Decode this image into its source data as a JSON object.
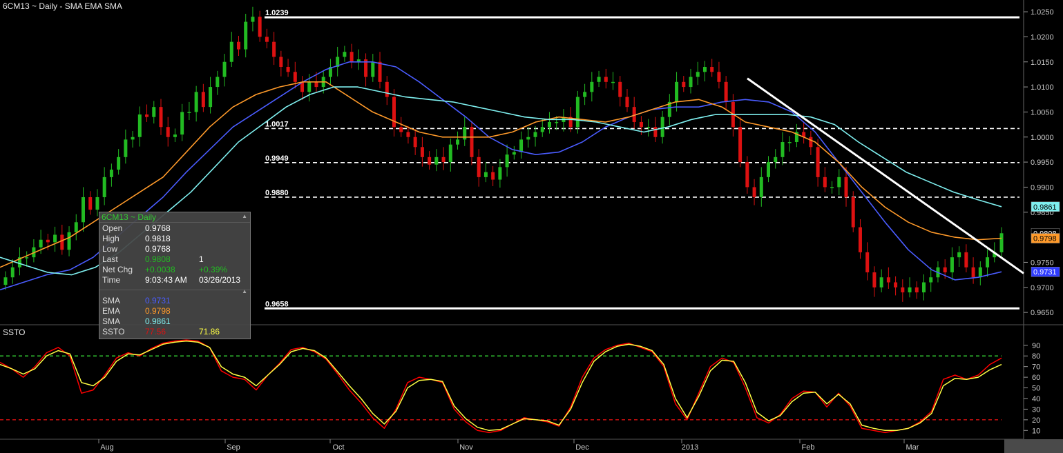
{
  "title": "6CM13 ~ Daily  -  SMA EMA SMA",
  "oscillator_title": "SSTO",
  "info_panel": {
    "header": "6CM13 ~ Daily",
    "rows": [
      {
        "label": "Open",
        "value": "0.9768",
        "value2": "",
        "color": "#ffffff"
      },
      {
        "label": "High",
        "value": "0.9818",
        "value2": "",
        "color": "#ffffff"
      },
      {
        "label": "Low",
        "value": "0.9768",
        "value2": "",
        "color": "#ffffff"
      },
      {
        "label": "Last",
        "value": "0.9808",
        "value2": "1",
        "color": "#22bb22"
      },
      {
        "label": "Net Chg",
        "value": "+0.0038",
        "value2": "+0.39%",
        "color": "#22bb22"
      },
      {
        "label": "Time",
        "value": "9:03:43 AM",
        "value2": "03/26/2013",
        "color": "#ffffff"
      }
    ],
    "studies": [
      {
        "label": "SMA",
        "value": "0.9731",
        "value2": "",
        "color": "#4a5cff"
      },
      {
        "label": "EMA",
        "value": "0.9798",
        "value2": "",
        "color": "#ff9a2a"
      },
      {
        "label": "SMA",
        "value": "0.9861",
        "value2": "",
        "color": "#7ff0f0"
      },
      {
        "label": "SSTO",
        "value": "77.56",
        "value2": "71.86",
        "color": "#dd1111",
        "color2": "#ffff44"
      }
    ]
  },
  "colors": {
    "background": "#000000",
    "up_candle": "#22bb22",
    "down_candle": "#dd1111",
    "sma_fast": "#4a5cff",
    "ema": "#ff9a2a",
    "sma_slow": "#7ff0f0",
    "ssto_k": "#ff0000",
    "ssto_d": "#ffff44",
    "level_line": "#ffffff",
    "axis_text": "#cccccc"
  },
  "chart_data": [
    {
      "type": "candlestick",
      "title": "6CM13 ~ Daily",
      "x_ticks": [
        "Aug",
        "Sep",
        "Oct",
        "Nov",
        "Dec",
        "2013",
        "Feb",
        "Mar"
      ],
      "y_ticks": [
        "1.0250",
        "1.0200",
        "1.0150",
        "1.0100",
        "1.0050",
        "1.0000",
        "0.9950",
        "0.9900",
        "0.9850",
        "0.9750",
        "0.9700",
        "0.9650"
      ],
      "ylim": [
        0.9635,
        1.0268
      ],
      "levels": [
        {
          "label": "1.0239",
          "value": 1.0239,
          "style": "solid"
        },
        {
          "label": "1.0017",
          "value": 1.0017,
          "style": "dashed"
        },
        {
          "label": "0.9949",
          "value": 0.9949,
          "style": "dashed"
        },
        {
          "label": "0.9880",
          "value": 0.988,
          "style": "dashed"
        },
        {
          "label": "0.9658",
          "value": 0.9658,
          "style": "solid"
        }
      ],
      "trendline": {
        "start": [
          "mid-Jan",
          1.0117
        ],
        "end": [
          "late-Mar",
          0.9728
        ]
      },
      "price_badges": [
        {
          "label": "0.9861",
          "value": 0.9861,
          "bg": "#7ff0f0",
          "fg": "#000000"
        },
        {
          "label": "0.9808",
          "value": 0.9808,
          "bg": "#000000",
          "fg": "#ffffff"
        },
        {
          "label": "0.9798",
          "value": 0.9798,
          "bg": "#ff9a2a",
          "fg": "#000000"
        },
        {
          "label": "0.9731",
          "value": 0.9731,
          "bg": "#2f3cff",
          "fg": "#ffffff"
        }
      ],
      "price_path": [
        0.972,
        0.974,
        0.976,
        0.976,
        0.978,
        0.9795,
        0.979,
        0.9805,
        0.9775,
        0.981,
        0.983,
        0.988,
        0.9855,
        0.988,
        0.992,
        0.9935,
        0.996,
        0.9995,
        1.0,
        1.0045,
        1.004,
        1.006,
        1.002,
        1.0,
        1.0005,
        1.005,
        1.005,
        1.009,
        1.006,
        1.01,
        1.012,
        1.015,
        1.019,
        1.0175,
        1.023,
        1.024,
        1.02,
        1.019,
        1.016,
        1.014,
        1.013,
        1.011,
        1.009,
        1.011,
        1.01,
        1.012,
        1.014,
        1.016,
        1.017,
        1.015,
        1.0155,
        1.012,
        1.015,
        1.011,
        1.008,
        1.002,
        1.001,
        1.0,
        0.998,
        0.996,
        0.9945,
        0.996,
        0.995,
        0.9985,
        0.9995,
        1.002,
        0.996,
        0.992,
        0.993,
        0.9915,
        0.994,
        0.9965,
        0.997,
        0.9995,
        1.0,
        1.001,
        1.002,
        1.003,
        1.003,
        1.004,
        1.002,
        1.008,
        1.009,
        1.011,
        1.012,
        1.011,
        1.011,
        1.008,
        1.006,
        1.003,
        1.002,
        1.002,
        1.0,
        1.004,
        1.007,
        1.011,
        1.01,
        1.012,
        1.013,
        1.014,
        1.013,
        1.011,
        1.007,
        1.002,
        0.995,
        0.99,
        0.988,
        0.992,
        0.995,
        0.996,
        0.999,
        0.999,
        1.001,
        1.0,
        0.998,
        0.992,
        0.99,
        0.99,
        0.992,
        0.988,
        0.982,
        0.977,
        0.973,
        0.97,
        0.972,
        0.971,
        0.97,
        0.969,
        0.97,
        0.969,
        0.971,
        0.972,
        0.974,
        0.973,
        0.976,
        0.977,
        0.974,
        0.972,
        0.974,
        0.976,
        0.977,
        0.9808
      ],
      "series": [
        {
          "name": "SMA",
          "color": "#4a5cff",
          "values": [
            0.9695,
            0.971,
            0.9725,
            0.9735,
            0.976,
            0.98,
            0.984,
            0.988,
            0.993,
            0.9975,
            1.002,
            1.005,
            1.008,
            1.011,
            1.0135,
            1.015,
            1.015,
            1.014,
            1.011,
            1.0075,
            1.004,
            1.0,
            0.9975,
            0.9965,
            0.997,
            0.999,
            1.002,
            1.004,
            1.0055,
            1.006,
            1.006,
            1.007,
            1.0075,
            1.007,
            1.005,
            1.001,
            0.995,
            0.989,
            0.983,
            0.9775,
            0.9735,
            0.9715,
            0.972,
            0.9731
          ]
        },
        {
          "name": "EMA",
          "color": "#ff9a2a",
          "values": [
            0.974,
            0.976,
            0.978,
            0.98,
            0.983,
            0.986,
            0.989,
            0.992,
            0.997,
            1.002,
            1.006,
            1.0085,
            1.01,
            1.011,
            1.011,
            1.008,
            1.005,
            1.003,
            1.001,
            1.0,
            1.0,
            1.0,
            1.001,
            1.003,
            1.004,
            1.0035,
            1.003,
            1.004,
            1.0055,
            1.007,
            1.0075,
            1.006,
            1.003,
            1.002,
            1.001,
            0.999,
            0.995,
            0.99,
            0.986,
            0.983,
            0.981,
            0.98,
            0.9795,
            0.9798
          ]
        },
        {
          "name": "SMA",
          "color": "#7ff0f0",
          "values": [
            0.976,
            0.9745,
            0.973,
            0.9725,
            0.974,
            0.977,
            0.981,
            0.985,
            0.989,
            0.994,
            0.999,
            1.0025,
            1.006,
            1.0085,
            1.01,
            1.01,
            1.009,
            1.008,
            1.0075,
            1.007,
            1.006,
            1.005,
            1.004,
            1.0035,
            1.0035,
            1.003,
            1.002,
            1.001,
            1.002,
            1.0035,
            1.0045,
            1.0045,
            1.0045,
            1.0045,
            1.004,
            1.0025,
            0.999,
            0.996,
            0.993,
            0.991,
            0.989,
            0.9875,
            0.9861
          ]
        }
      ]
    },
    {
      "type": "line",
      "title": "SSTO",
      "y_ticks": [
        "90",
        "80",
        "70",
        "60",
        "50",
        "40",
        "30",
        "20",
        "10"
      ],
      "ylim": [
        5,
        97
      ],
      "levels": [
        {
          "value": 80,
          "color": "#33cc33",
          "style": "dashed"
        },
        {
          "value": 20,
          "color": "#dd1111",
          "style": "dashed"
        }
      ],
      "series": [
        {
          "name": "%K",
          "color": "#ff0000",
          "values": [
            74,
            68,
            60,
            70,
            83,
            88,
            80,
            45,
            48,
            62,
            78,
            83,
            80,
            87,
            92,
            94,
            95,
            94,
            88,
            66,
            60,
            58,
            48,
            62,
            73,
            86,
            88,
            84,
            77,
            63,
            48,
            36,
            22,
            12,
            30,
            55,
            60,
            58,
            55,
            30,
            18,
            10,
            8,
            10,
            16,
            22,
            20,
            18,
            14,
            32,
            60,
            78,
            86,
            90,
            92,
            88,
            84,
            70,
            35,
            20,
            45,
            70,
            78,
            74,
            50,
            22,
            17,
            25,
            40,
            47,
            46,
            32,
            45,
            33,
            12,
            10,
            8,
            10,
            12,
            18,
            28,
            58,
            62,
            58,
            62,
            72,
            78
          ]
        },
        {
          "name": "%D",
          "color": "#ffff44",
          "values": [
            72,
            68,
            63,
            68,
            80,
            85,
            82,
            55,
            52,
            60,
            75,
            82,
            81,
            86,
            91,
            93,
            94,
            93,
            88,
            70,
            63,
            60,
            52,
            62,
            72,
            84,
            87,
            85,
            78,
            65,
            52,
            40,
            26,
            16,
            28,
            50,
            57,
            58,
            56,
            33,
            21,
            13,
            10,
            11,
            16,
            21,
            20,
            19,
            15,
            30,
            55,
            75,
            84,
            89,
            91,
            89,
            85,
            72,
            40,
            22,
            42,
            66,
            76,
            75,
            55,
            27,
            19,
            24,
            37,
            45,
            46,
            35,
            44,
            35,
            15,
            12,
            10,
            10,
            12,
            17,
            26,
            52,
            59,
            58,
            60,
            67,
            72
          ]
        }
      ]
    }
  ]
}
